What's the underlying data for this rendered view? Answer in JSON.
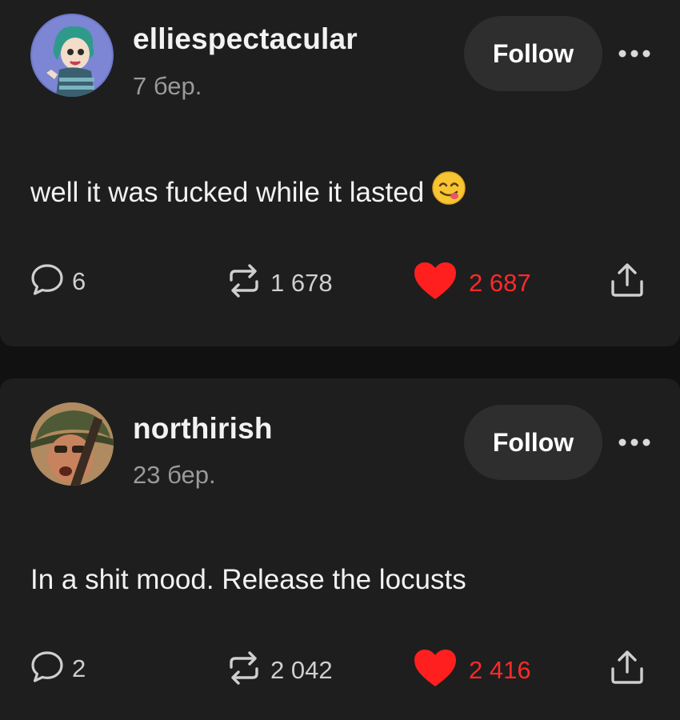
{
  "colors": {
    "background": "#111111",
    "card": "#1e1e1e",
    "follow_button": "#2e2e2e",
    "like": "#ff2a2a",
    "text_muted": "#9a9a9a"
  },
  "posts": [
    {
      "username": "elliespectacular",
      "timestamp": "7 бер.",
      "follow_label": "Follow",
      "text": "well it was fucked while it lasted",
      "emoji": "face-savoring-food",
      "comments": "6",
      "reblogs": "1 678",
      "likes": "2 687",
      "liked": true
    },
    {
      "username": "northirish",
      "timestamp": "23 бер.",
      "follow_label": "Follow",
      "text": "In a shit mood. Release the locusts",
      "comments": "2",
      "reblogs": "2 042",
      "likes": "2 416",
      "liked": true
    }
  ],
  "icons": {
    "more": "more-horizontal-icon",
    "comment": "comment-bubble-icon",
    "reblog": "reblog-arrows-icon",
    "like": "heart-icon",
    "share": "share-icon"
  }
}
